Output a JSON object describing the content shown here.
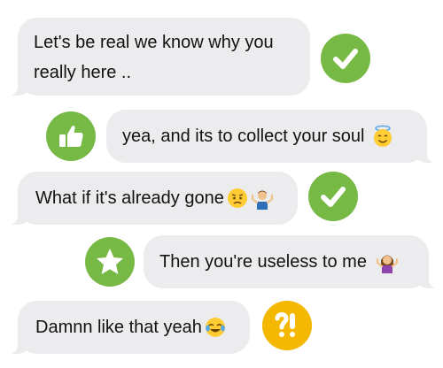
{
  "messages": [
    {
      "text_line1": "Let's be real we know why you",
      "text_line2": "really here ..",
      "tapback": "checkmark-icon"
    },
    {
      "text": "yea, and its to collect your soul",
      "emoji": "smiling-face-with-halo-emoji",
      "tapback": "thumbs-up-icon"
    },
    {
      "text": "What if it's already gone",
      "emoji": [
        "worried-face-emoji",
        "man-shrugging-emoji"
      ],
      "tapback": "checkmark-icon"
    },
    {
      "text": "Then you're useless to me",
      "emoji": "woman-shrugging-emoji",
      "tapback": "star-icon"
    },
    {
      "text": "Damnn like that yeah",
      "emoji": "face-with-tears-of-joy-emoji",
      "tapback": "interrobang-icon"
    }
  ],
  "colors": {
    "bubble": "#ececee",
    "tapback_green": "#76b945",
    "tapback_yellow": "#f5b800"
  }
}
